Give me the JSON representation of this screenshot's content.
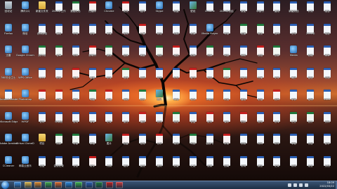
{
  "desktop": {
    "wallpaper": "sunset-tree",
    "columns": [
      [
        {
          "k": "bin",
          "l": "回收站"
        },
        {
          "k": "app",
          "l": "Firefox"
        },
        {
          "k": "app",
          "l": "迅雷"
        },
        {
          "k": "app",
          "l": "360安全卫士"
        },
        {
          "k": "doc",
          "l": "Acrobat Reader DC"
        },
        {
          "k": "app",
          "l": "Microsoft Edge"
        },
        {
          "k": "app",
          "l": "Adobe Acrobat"
        },
        {
          "k": "app",
          "l": "CCleaner"
        }
      ],
      [
        {
          "k": "app",
          "l": "腾讯QQ"
        },
        {
          "k": "app",
          "l": "微信"
        },
        {
          "k": "app",
          "l": "Google Chrome"
        },
        {
          "k": "app",
          "l": "WPS Office"
        },
        {
          "k": "app",
          "l": "Photoshop"
        },
        {
          "k": "app",
          "l": "HiPDF"
        },
        {
          "k": "app",
          "l": "Virtual CloneDrive"
        },
        {
          "k": "app",
          "l": "网易云音乐"
        }
      ],
      [
        {
          "k": "folder",
          "l": "新建文件夹"
        },
        {
          "k": "doc",
          "l": "说明文档"
        },
        {
          "k": "xls",
          "l": "统计表"
        },
        {
          "k": "doc",
          "l": "word"
        },
        {
          "k": "pdf",
          "l": "资料"
        },
        {
          "k": "doc",
          "l": "合同"
        },
        {
          "k": "folder",
          "l": "项目"
        },
        {
          "k": "doc",
          "l": "总结"
        }
      ],
      [
        {
          "k": "doc",
          "l": "2022年工作"
        },
        {
          "k": "doc",
          "l": "通知"
        },
        {
          "k": "xls",
          "l": "名单"
        },
        {
          "k": "doc",
          "l": "报告"
        },
        {
          "k": "pdf",
          "l": "方案"
        },
        {
          "k": "doc",
          "l": "申请表"
        },
        {
          "k": "xls",
          "l": "预算"
        },
        {
          "k": "doc",
          "l": "会议记录"
        }
      ],
      [
        {
          "k": "xls",
          "l": "数据汇总"
        },
        {
          "k": "doc",
          "l": "计划"
        },
        {
          "k": "doc",
          "l": "材料"
        },
        {
          "k": "pdf",
          "l": "发票"
        },
        {
          "k": "doc",
          "l": "简历"
        },
        {
          "k": "doc",
          "l": "证明"
        },
        {
          "k": "xls",
          "l": "考勤"
        },
        {
          "k": "doc",
          "l": "公告"
        }
      ],
      [
        {
          "k": "pdf",
          "l": "扫描件"
        },
        {
          "k": "doc",
          "l": "文件"
        },
        {
          "k": "pdf",
          "l": "说明书"
        },
        {
          "k": "doc",
          "l": "模板"
        },
        {
          "k": "xls",
          "l": "明细"
        },
        {
          "k": "doc",
          "l": "清单"
        },
        {
          "k": "doc",
          "l": "草稿"
        },
        {
          "k": "pdf",
          "l": "附件"
        }
      ],
      [
        {
          "k": "app",
          "l": "Chrome"
        },
        {
          "k": "doc",
          "l": "草案"
        },
        {
          "k": "xls",
          "l": "报表"
        },
        {
          "k": "doc",
          "l": "协议"
        },
        {
          "k": "pdf",
          "l": "图纸"
        },
        {
          "k": "doc",
          "l": "记录"
        },
        {
          "k": "img",
          "l": "图片"
        },
        {
          "k": "doc",
          "l": "大纲"
        }
      ],
      [
        {
          "k": "pdf",
          "l": "发文"
        },
        {
          "k": "doc",
          "l": "笔记"
        },
        {
          "k": "doc",
          "l": "目录"
        },
        {
          "k": "xls",
          "l": "台账"
        },
        {
          "k": "doc",
          "l": "讲稿"
        },
        {
          "k": "doc",
          "l": "备忘"
        },
        {
          "k": "pdf",
          "l": "批复"
        },
        {
          "k": "doc",
          "l": "稿件"
        }
      ],
      [
        {
          "k": "doc",
          "l": "函件"
        },
        {
          "k": "pdf",
          "l": "汇编"
        },
        {
          "k": "doc",
          "l": "摘要"
        },
        {
          "k": "doc",
          "l": "说明"
        },
        {
          "k": "xls",
          "l": "统计"
        },
        {
          "k": "pdf",
          "l": "通报"
        },
        {
          "k": "doc",
          "l": "意见"
        },
        {
          "k": "doc",
          "l": "要点"
        }
      ],
      [
        {
          "k": "app",
          "l": "Skype"
        },
        {
          "k": "doc",
          "l": "综述"
        },
        {
          "k": "xls",
          "l": "成绩"
        },
        {
          "k": "doc",
          "l": "任务"
        },
        {
          "k": "img",
          "l": "照片"
        },
        {
          "k": "doc",
          "l": "安排"
        },
        {
          "k": "pdf",
          "l": "公示"
        },
        {
          "k": "doc",
          "l": "细则"
        }
      ],
      [
        {
          "k": "doc",
          "l": "制度"
        },
        {
          "k": "doc",
          "l": "流程"
        },
        {
          "k": "pdf",
          "l": "规范"
        },
        {
          "k": "doc",
          "l": "办法"
        },
        {
          "k": "doc",
          "l": "标准"
        },
        {
          "k": "xls",
          "l": "账目"
        },
        {
          "k": "doc",
          "l": "规划"
        },
        {
          "k": "doc",
          "l": "纪要"
        }
      ],
      [
        {
          "k": "img",
          "l": "壁纸"
        },
        {
          "k": "doc",
          "l": "文案"
        },
        {
          "k": "doc",
          "l": "提纲"
        },
        {
          "k": "pdf",
          "l": "证书"
        },
        {
          "k": "doc",
          "l": "论文"
        },
        {
          "k": "doc",
          "l": "答复"
        },
        {
          "k": "xls",
          "l": "列表"
        },
        {
          "k": "doc",
          "l": "汇报"
        }
      ],
      [
        {
          "k": "doc",
          "l": "Chrome"
        },
        {
          "k": "app",
          "l": "Media Player"
        },
        {
          "k": "xls",
          "l": "测算"
        },
        {
          "k": "doc",
          "l": "范文"
        },
        {
          "k": "doc",
          "l": "承诺书"
        },
        {
          "k": "pdf",
          "l": "批件"
        },
        {
          "k": "doc",
          "l": "倡议书"
        },
        {
          "k": "doc",
          "l": "提案"
        }
      ],
      [
        {
          "k": "doc",
          "l": "2021年总结"
        },
        {
          "k": "doc",
          "l": "年报"
        },
        {
          "k": "doc",
          "l": "简报"
        },
        {
          "k": "xls",
          "l": "核算"
        },
        {
          "k": "doc",
          "l": "决议"
        },
        {
          "k": "doc",
          "l": "课件"
        },
        {
          "k": "pdf",
          "l": "手册"
        },
        {
          "k": "doc",
          "l": "指南"
        }
      ],
      [
        {
          "k": "doc",
          "l": "变更"
        },
        {
          "k": "xls",
          "l": "进度"
        },
        {
          "k": "doc",
          "l": "调研"
        },
        {
          "k": "doc",
          "l": "计划书"
        },
        {
          "k": "doc",
          "l": "建议"
        },
        {
          "k": "pdf",
          "l": "回执"
        },
        {
          "k": "doc",
          "l": "须知"
        },
        {
          "k": "doc",
          "l": "说明"
        }
      ],
      [
        {
          "k": "doc",
          "l": "申报书"
        },
        {
          "k": "xls",
          "l": "收支"
        },
        {
          "k": "pdf",
          "l": "公函"
        },
        {
          "k": "doc",
          "l": "方案"
        },
        {
          "k": "doc",
          "l": "总结"
        },
        {
          "k": "doc",
          "l": "答辩"
        },
        {
          "k": "doc",
          "l": "材料"
        },
        {
          "k": "doc",
          "l": "报告"
        }
      ],
      [
        {
          "k": "doc",
          "l": "通知"
        },
        {
          "k": "doc",
          "l": "合同"
        },
        {
          "k": "xls",
          "l": "预算"
        },
        {
          "k": "doc",
          "l": "文件"
        },
        {
          "k": "pdf",
          "l": "资料"
        },
        {
          "k": "doc",
          "l": "名单"
        },
        {
          "k": "doc",
          "l": "附件"
        },
        {
          "k": "doc",
          "l": "记录"
        }
      ],
      [
        {
          "k": "doc",
          "l": "新建文档"
        },
        {
          "k": "doc",
          "l": "工作"
        },
        {
          "k": "app",
          "l": "Media"
        },
        {
          "k": "doc",
          "l": "简历"
        },
        {
          "k": "doc",
          "l": "申请"
        },
        {
          "k": "xls",
          "l": "汇总"
        },
        {
          "k": "doc",
          "l": "草稿"
        },
        {
          "k": "doc",
          "l": "说明"
        }
      ],
      [
        {
          "k": "doc",
          "l": "计划"
        },
        {
          "k": "doc",
          "l": "2022年"
        },
        {
          "k": "doc",
          "l": "表格"
        },
        {
          "k": "doc",
          "l": "会议"
        },
        {
          "k": "doc",
          "l": "证明"
        },
        {
          "k": "xls",
          "l": "统计"
        },
        {
          "k": "doc",
          "l": "公告"
        },
        {
          "k": "doc",
          "l": "发言"
        }
      ],
      [
        {
          "k": "doc",
          "l": "报告"
        },
        {
          "k": "doc",
          "l": "规定"
        },
        {
          "k": "doc",
          "l": "清单"
        },
        {
          "k": "doc",
          "l": "总结"
        },
        {
          "k": "doc",
          "l": "2021"
        },
        {
          "k": "doc",
          "l": "资料"
        },
        {
          "k": "doc",
          "l": "要求"
        },
        {
          "k": "doc",
          "l": "文档"
        }
      ]
    ]
  },
  "taskbar": {
    "apps": [
      {
        "k": "app",
        "name": "ie-icon",
        "color": "#3f8fe0"
      },
      {
        "k": "folder",
        "name": "explorer-icon",
        "color": "#e3b94a"
      },
      {
        "k": "app",
        "name": "media-player-icon",
        "color": "#e08a2a"
      },
      {
        "k": "app",
        "name": "chrome-icon",
        "color": "#3faa4a"
      },
      {
        "k": "app",
        "name": "firefox-icon",
        "color": "#e0692a"
      },
      {
        "k": "app",
        "name": "qq-icon",
        "color": "#2a8ae0"
      },
      {
        "k": "app",
        "name": "wechat-icon",
        "color": "#3cb34a"
      },
      {
        "k": "doc",
        "name": "word-icon",
        "color": "#2b5fb4"
      },
      {
        "k": "xls",
        "name": "excel-icon",
        "color": "#1f7a3d"
      },
      {
        "k": "pdf",
        "name": "pdf-icon",
        "color": "#c41e1e"
      },
      {
        "k": "app",
        "name": "wps-icon",
        "color": "#d03a3a"
      }
    ],
    "clock": {
      "time": "18:09",
      "date": "2022/03/22"
    }
  }
}
